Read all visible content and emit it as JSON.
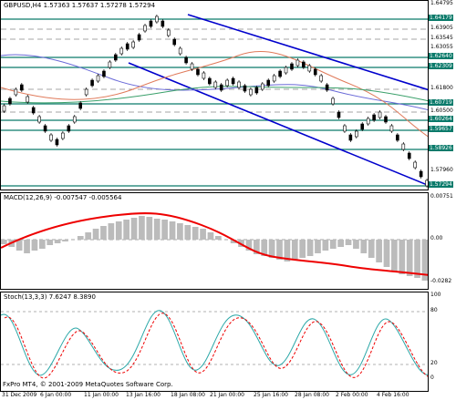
{
  "header": {
    "text": "GBPUSD,H4  1.57363 1.57637 1.57278 1.57294"
  },
  "macd_label": "MACD(12,26,9) -0.007547 -0.005564",
  "stoch_label": "Stoch(13,3,3) 7.6247 8.3890",
  "copyright": "FxPro MT4, © 2001-2009 MetaQuotes Software Corp.",
  "price_axis": [
    {
      "v": "1.64795",
      "hl": false
    },
    {
      "v": "1.64179",
      "hl": true
    },
    {
      "v": "1.63905",
      "hl": false
    },
    {
      "v": "1.63545",
      "hl": false
    },
    {
      "v": "1.63055",
      "hl": false
    },
    {
      "v": "1.62640",
      "hl": true
    },
    {
      "v": "1.62309",
      "hl": true
    },
    {
      "v": "1.61800",
      "hl": false
    },
    {
      "v": "1.60719",
      "hl": true
    },
    {
      "v": "1.60500",
      "hl": false
    },
    {
      "v": "1.60264",
      "hl": true
    },
    {
      "v": "1.59657",
      "hl": true
    },
    {
      "v": "1.58926",
      "hl": true
    },
    {
      "v": "1.57960",
      "hl": false
    },
    {
      "v": "1.57294",
      "hl": true
    }
  ],
  "macd_axis": [
    "0.00751",
    "0.00",
    "-0.0282"
  ],
  "stoch_axis": [
    "100",
    "80",
    "20",
    "0"
  ],
  "x_labels": [
    "31 Dec 2009",
    "6 Jan 00:00",
    "11 Jan 00:00",
    "13 Jan 16:00",
    "18 Jan 08:00",
    "21 Jan 00:00",
    "25 Jan 16:00",
    "28 Jan 08:00",
    "2 Feb 00:00",
    "4 Feb 16:00"
  ],
  "colors": {
    "channel": "#0000cc",
    "sr_line": "#0a7a6a",
    "macd_signal": "#ee0000",
    "macd_hist": "#bbbbbb",
    "stoch_main": "#2aa7a7",
    "stoch_signal": "#ee0000"
  }
}
